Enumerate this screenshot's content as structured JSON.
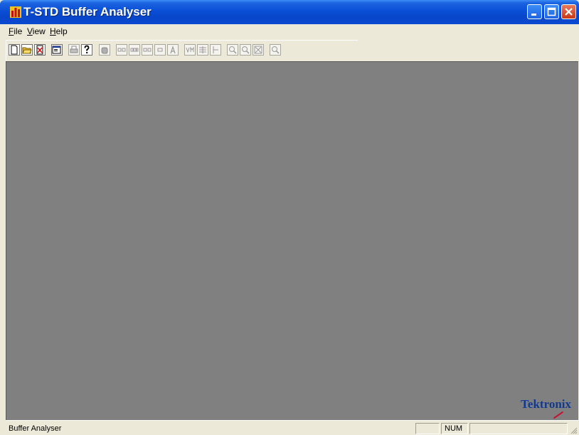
{
  "window": {
    "title": "T-STD Buffer Analyser"
  },
  "caption_buttons": {
    "minimize": "minimize",
    "maximize": "maximize",
    "close": "close"
  },
  "menu": {
    "file": {
      "access": "F",
      "rest": "ile"
    },
    "view": {
      "access": "V",
      "rest": "iew"
    },
    "help": {
      "access": "H",
      "rest": "elp"
    }
  },
  "toolbar": {
    "buttons": [
      "new-icon",
      "open-icon",
      "close-file-icon",
      "properties-icon",
      "print-icon",
      "help-icon",
      "hand-icon",
      "pb-icon",
      "pcr-icon",
      "eb-icon",
      "eb-small-icon",
      "a-icon",
      "vm-icon",
      "grid-icon",
      "cursor-icon",
      "zoom-in-icon",
      "zoom-out-icon",
      "zoom-fit-icon",
      "zoom-icon"
    ]
  },
  "logo": {
    "text": "Tektronix"
  },
  "status": {
    "text": "Buffer Analyser",
    "num": "NUM",
    "empty": ""
  }
}
